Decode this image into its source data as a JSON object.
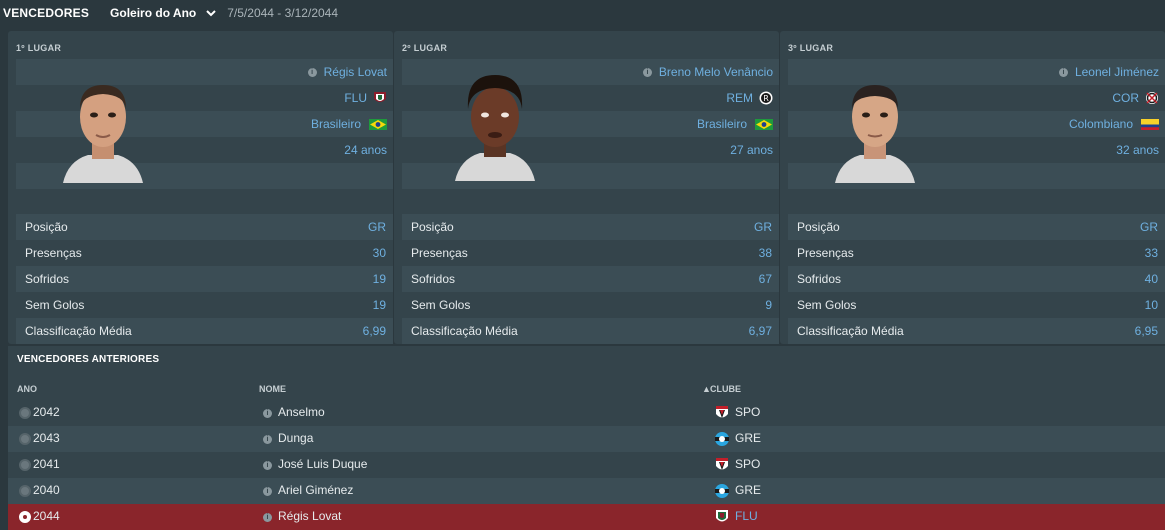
{
  "header": {
    "title": "VENCEDORES",
    "award": "Goleiro do Ano",
    "dates": "7/5/2044 - 3/12/2044"
  },
  "winners": [
    {
      "place": "1º LUGAR",
      "name": "Régis Lovat",
      "club": "FLU",
      "nationality": "Brasileiro",
      "age": "24 anos",
      "crest": "fluminense-crest-icon",
      "flag": "brazil-flag-icon",
      "stats": [
        {
          "label": "Posição",
          "value": "GR"
        },
        {
          "label": "Presenças",
          "value": "30"
        },
        {
          "label": "Sofridos",
          "value": "19"
        },
        {
          "label": "Sem Golos",
          "value": "19"
        },
        {
          "label": "Classificação Média",
          "value": "6,99"
        }
      ]
    },
    {
      "place": "2º LUGAR",
      "name": "Breno Melo Venâncio",
      "club": "REM",
      "nationality": "Brasileiro",
      "age": "27 anos",
      "crest": "remo-crest-icon",
      "flag": "brazil-flag-icon",
      "stats": [
        {
          "label": "Posição",
          "value": "GR"
        },
        {
          "label": "Presenças",
          "value": "38"
        },
        {
          "label": "Sofridos",
          "value": "67"
        },
        {
          "label": "Sem Golos",
          "value": "9"
        },
        {
          "label": "Classificação Média",
          "value": "6,97"
        }
      ]
    },
    {
      "place": "3º LUGAR",
      "name": "Leonel Jiménez",
      "club": "COR",
      "nationality": "Colombiano",
      "age": "32 anos",
      "crest": "corinthians-crest-icon",
      "flag": "colombia-flag-icon",
      "stats": [
        {
          "label": "Posição",
          "value": "GR"
        },
        {
          "label": "Presenças",
          "value": "33"
        },
        {
          "label": "Sofridos",
          "value": "40"
        },
        {
          "label": "Sem Golos",
          "value": "10"
        },
        {
          "label": "Classificação Média",
          "value": "6,95"
        }
      ]
    }
  ],
  "history": {
    "title": "VENCEDORES ANTERIORES",
    "columns": {
      "year": "ANO",
      "name": "NOME",
      "club": "CLUBE"
    },
    "rows": [
      {
        "year": "2042",
        "name": "Anselmo",
        "club": "SPO",
        "crest": "sao-paulo-crest-icon"
      },
      {
        "year": "2043",
        "name": "Dunga",
        "club": "GRE",
        "crest": "gremio-crest-icon"
      },
      {
        "year": "2041",
        "name": "José Luis Duque",
        "club": "SPO",
        "crest": "sao-paulo-crest-icon"
      },
      {
        "year": "2040",
        "name": "Ariel Giménez",
        "club": "GRE",
        "crest": "gremio-crest-icon"
      },
      {
        "year": "2044",
        "name": "Régis Lovat",
        "club": "FLU",
        "crest": "fluminense-crest-icon",
        "selected": true
      }
    ]
  },
  "colors": {
    "background": "#2b383e",
    "card": "#34444b",
    "link": "#6fb0e0",
    "selected_row": "#8a252b"
  }
}
